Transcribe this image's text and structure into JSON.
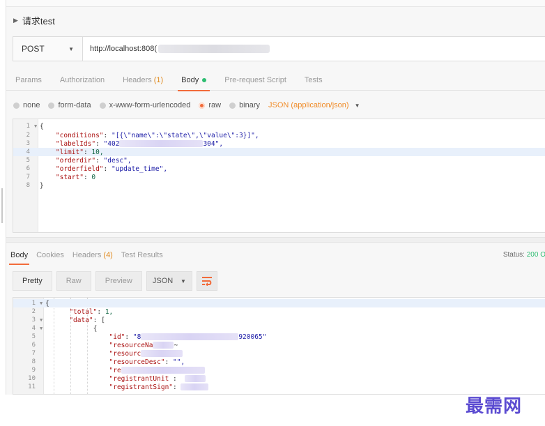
{
  "request": {
    "name": "请求test",
    "method": "POST",
    "url": "http://localhost:808("
  },
  "request_tabs": [
    {
      "label": "Params"
    },
    {
      "label": "Authorization"
    },
    {
      "label": "Headers",
      "count": "(1)"
    },
    {
      "label": "Body",
      "active": true
    },
    {
      "label": "Pre-request Script"
    },
    {
      "label": "Tests"
    }
  ],
  "body_types": {
    "none": "none",
    "form_data": "form-data",
    "urlencoded": "x-www-form-urlencoded",
    "raw": "raw",
    "binary": "binary",
    "content_type": "JSON (application/json)"
  },
  "request_body": {
    "lines": [
      "1",
      "2",
      "3",
      "4",
      "5",
      "6",
      "7",
      "8"
    ],
    "open_brace": "{",
    "conditions_key": "\"conditions\"",
    "conditions_val": "\"[{\\\"name\\\":\\\"state\\\",\\\"value\\\":3}]\",",
    "labelids_key": "\"labelIds\"",
    "labelids_start": "\"402",
    "labelids_end": "304\",",
    "limit_key": "\"limit\"",
    "limit_val": "10,",
    "orderdir_key": "\"orderdir\"",
    "orderdir_val": "\"desc\",",
    "orderfield_key": "\"orderfield\"",
    "orderfield_val": "\"update_time\",",
    "start_key": "\"start\"",
    "start_val": "0",
    "close_brace": "}"
  },
  "response": {
    "tabs": [
      {
        "label": "Body",
        "active": true
      },
      {
        "label": "Cookies"
      },
      {
        "label": "Headers",
        "count": "(4)"
      },
      {
        "label": "Test Results"
      }
    ],
    "status_label": "Status:",
    "status_value": "200 O",
    "views": [
      "Pretty",
      "Raw",
      "Preview"
    ],
    "format": "JSON",
    "lines": [
      "1",
      "2",
      "3",
      "4",
      "5",
      "6",
      "7",
      "8",
      "9",
      "10",
      "11"
    ],
    "l1": "{",
    "total_key": "\"total\"",
    "total_val": "1,",
    "data_key": "\"data\"",
    "data_val": "[",
    "l4": "{",
    "id_key": "\"id\"",
    "id_start": "\"8",
    "id_end": "920065\"",
    "resname_key": "\"resourceNa",
    "resname_tail": "~",
    "resource_key": "\"resourc",
    "resdesc_key": "\"resourceDesc\"",
    "resdesc_val": "\"\",",
    "re_key": "\"re",
    "regunit_key": "\"registrantUnit",
    "regsign_key": "\"registrantSign\""
  },
  "watermark": "最需网",
  "colors": {
    "accent": "#f26b3a",
    "green": "#2dbd71",
    "orange": "#e08a1e",
    "watermark": "#5b4bd1"
  }
}
